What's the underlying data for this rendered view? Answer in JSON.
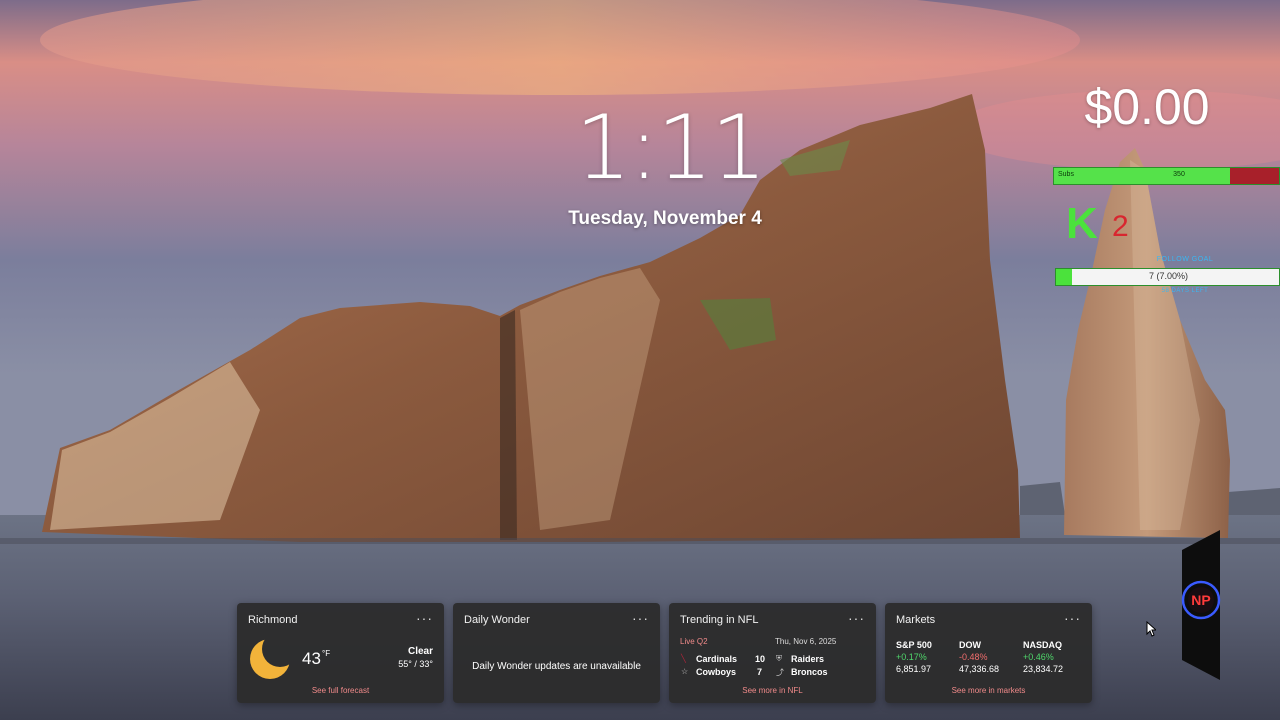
{
  "lockscreen": {
    "time": "1:11",
    "date": "Tuesday, November 4"
  },
  "overlay": {
    "money": "$0.00",
    "subs_label": "Subs",
    "subs_count": "350",
    "subs_progress": 0.78,
    "k_letter": "K",
    "k_count": "2",
    "follow_goal_label": "FOLLOW GOAL",
    "follow_text": "7 (7.00%)",
    "follow_progress": 0.07,
    "days_left_label": "58 DAYS LEFT",
    "logo_icon": "np-neon-logo-icon",
    "colors": {
      "green": "#4be23c",
      "red": "#d8262f",
      "blue": "#3ab6f2"
    }
  },
  "widgets": {
    "weather": {
      "title": "Richmond",
      "more": "···",
      "icon": "crescent-moon-icon",
      "temp": "43",
      "unit": "°F",
      "condition": "Clear",
      "range": "55° / 33°",
      "link": "See full forecast"
    },
    "wonder": {
      "title": "Daily Wonder",
      "more": "···",
      "message": "Daily Wonder updates are unavailable"
    },
    "nfl": {
      "title": "Trending in NFL",
      "more": "···",
      "status": "Live Q2",
      "date": "Thu, Nov  6, 2025",
      "game1": {
        "home": {
          "team": "Cardinals",
          "score": "10"
        },
        "away": {
          "team": "Cowboys",
          "score": "7"
        }
      },
      "game2": {
        "home": {
          "team": "Raiders"
        },
        "away": {
          "team": "Broncos"
        }
      },
      "link": "See more in NFL"
    },
    "markets": {
      "title": "Markets",
      "more": "···",
      "items": [
        {
          "name": "S&P 500",
          "change": "+0.17%",
          "value": "6,851.97",
          "direction": "up"
        },
        {
          "name": "DOW",
          "change": "-0.48%",
          "value": "47,336.68",
          "direction": "down"
        },
        {
          "name": "NASDAQ",
          "change": "+0.46%",
          "value": "23,834.72",
          "direction": "up"
        }
      ],
      "link": "See more in markets"
    }
  }
}
